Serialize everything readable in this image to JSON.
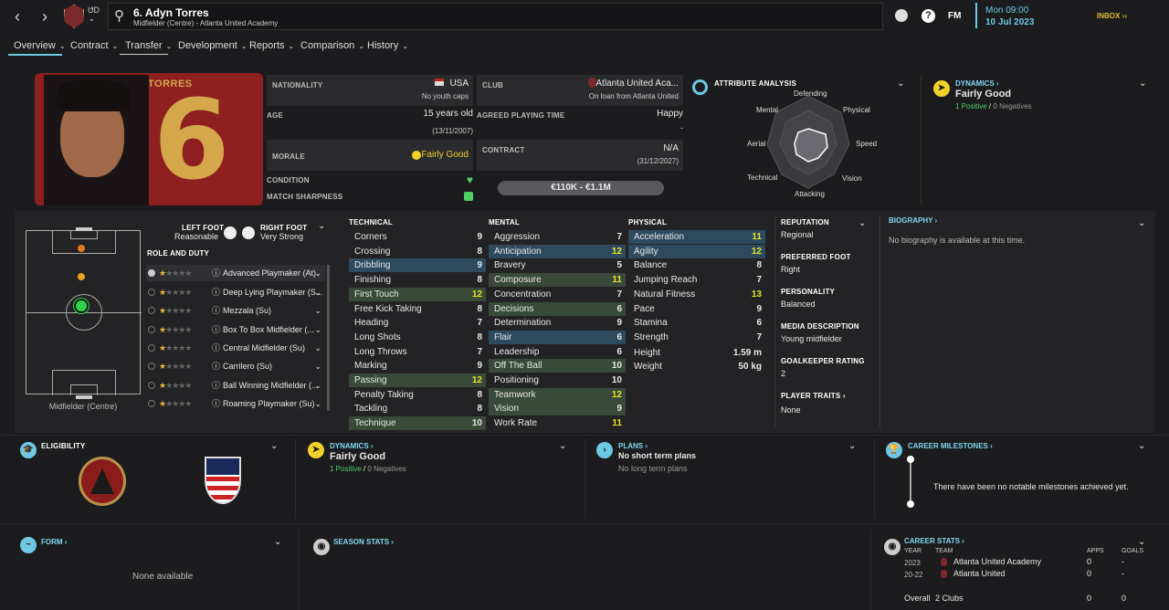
{
  "header": {
    "player_title": "6. Adyn Torres",
    "player_subtitle": "Midfielder (Centre) - Atlanta United Academy",
    "club_initials": "UD",
    "date_time": "Mon 09:00",
    "date": "10 Jul 2023",
    "inbox": "INBOX",
    "fm": "FM",
    "help": "?"
  },
  "tabs": [
    {
      "label": "Overview"
    },
    {
      "label": "Contract"
    },
    {
      "label": "Transfer"
    },
    {
      "label": "Development"
    },
    {
      "label": "Reports"
    },
    {
      "label": "Comparison"
    },
    {
      "label": "History"
    }
  ],
  "photo": {
    "shirt_name": "TORRES",
    "shirt_number": "6"
  },
  "info": {
    "nationality_label": "NATIONALITY",
    "nationality": "USA",
    "youth_caps": "No youth caps",
    "age_label": "AGE",
    "age": "15 years old",
    "dob": "(13/11/2007)",
    "morale_label": "MORALE",
    "morale": "Fairly Good",
    "condition_label": "CONDITION",
    "sharpness_label": "MATCH SHARPNESS",
    "club_label": "CLUB",
    "club": "Atlanta United Aca...",
    "loan": "On loan from Atlanta United",
    "apt_label": "AGREED PLAYING TIME",
    "apt": "Happy",
    "apt_dash": "-",
    "contract_label": "CONTRACT",
    "contract": "N/A",
    "contract_date": "(31/12/2027)",
    "value": "€110K - €1.1M"
  },
  "attribute_analysis": {
    "title": "ATTRIBUTE ANALYSIS",
    "labels": [
      "Defending",
      "Physical",
      "Speed",
      "Vision",
      "Attacking",
      "Technical",
      "Aerial",
      "Mental"
    ]
  },
  "dynamics": {
    "title": "DYNAMICS",
    "status": "Fairly Good",
    "positive": "1 Positive",
    "sep": "/",
    "negative": "0 Negatives"
  },
  "pitch": {
    "position": "Midfielder (Centre)",
    "left_foot_label": "LEFT FOOT",
    "left_foot": "Reasonable",
    "right_foot_label": "RIGHT FOOT",
    "right_foot": "Very Strong",
    "role_title": "ROLE AND DUTY"
  },
  "roles": [
    "Advanced Playmaker (At)",
    "Deep Lying Playmaker (S...",
    "Mezzala (Su)",
    "Box To Box Midfielder (...",
    "Central Midfielder (Su)",
    "Carrilero (Su)",
    "Ball Winning Midfielder (...",
    "Roaming Playmaker (Su)"
  ],
  "technical": {
    "title": "TECHNICAL",
    "rows": [
      [
        "Corners",
        "9"
      ],
      [
        "Crossing",
        "8"
      ],
      [
        "Dribbling",
        "9"
      ],
      [
        "Finishing",
        "8"
      ],
      [
        "First Touch",
        "12"
      ],
      [
        "Free Kick Taking",
        "8"
      ],
      [
        "Heading",
        "7"
      ],
      [
        "Long Shots",
        "8"
      ],
      [
        "Long Throws",
        "7"
      ],
      [
        "Marking",
        "9"
      ],
      [
        "Passing",
        "12"
      ],
      [
        "Penalty Taking",
        "8"
      ],
      [
        "Tackling",
        "8"
      ],
      [
        "Technique",
        "10"
      ]
    ]
  },
  "mental": {
    "title": "MENTAL",
    "rows": [
      [
        "Aggression",
        "7"
      ],
      [
        "Anticipation",
        "12"
      ],
      [
        "Bravery",
        "5"
      ],
      [
        "Composure",
        "11"
      ],
      [
        "Concentration",
        "7"
      ],
      [
        "Decisions",
        "6"
      ],
      [
        "Determination",
        "9"
      ],
      [
        "Flair",
        "6"
      ],
      [
        "Leadership",
        "6"
      ],
      [
        "Off The Ball",
        "10"
      ],
      [
        "Positioning",
        "10"
      ],
      [
        "Teamwork",
        "12"
      ],
      [
        "Vision",
        "9"
      ],
      [
        "Work Rate",
        "11"
      ]
    ]
  },
  "physical": {
    "title": "PHYSICAL",
    "rows": [
      [
        "Acceleration",
        "11"
      ],
      [
        "Agility",
        "12"
      ],
      [
        "Balance",
        "8"
      ],
      [
        "Jumping Reach",
        "7"
      ],
      [
        "Natural Fitness",
        "13"
      ],
      [
        "Pace",
        "9"
      ],
      [
        "Stamina",
        "6"
      ],
      [
        "Strength",
        "7"
      ]
    ],
    "height_label": "Height",
    "height": "1.59 m",
    "weight_label": "Weight",
    "weight": "50 kg"
  },
  "profile": {
    "reputation_label": "REPUTATION",
    "reputation": "Regional",
    "foot_label": "PREFERRED FOOT",
    "foot": "Right",
    "personality_label": "PERSONALITY",
    "personality": "Balanced",
    "media_label": "MEDIA DESCRIPTION",
    "media": "Young midfielder",
    "gk_label": "GOALKEEPER RATING",
    "gk": "2",
    "traits_label": "PLAYER TRAITS",
    "traits": "None"
  },
  "biography": {
    "title": "BIOGRAPHY",
    "text": "No biography is available at this time."
  },
  "eligibility": {
    "title": "ELIGIBILITY"
  },
  "plans": {
    "title": "PLANS",
    "short": "No short term plans",
    "long": "No long term plans"
  },
  "milestones": {
    "title": "CAREER MILESTONES",
    "text": "There have been no notable milestones achieved yet."
  },
  "form": {
    "title": "FORM",
    "text": "None available"
  },
  "season_stats": {
    "title": "SEASON STATS"
  },
  "career_stats": {
    "title": "CAREER STATS",
    "headers": [
      "YEAR",
      "TEAM",
      "APPS",
      "GOALS"
    ],
    "rows": [
      [
        "2023",
        "Atlanta United Academy",
        "0",
        "-"
      ],
      [
        "20-22",
        "Atlanta United",
        "0",
        "-"
      ]
    ],
    "overall_label": "Overall",
    "overall_clubs": "2 Clubs",
    "overall_apps": "0",
    "overall_goals": "0"
  },
  "colors": {
    "accent": "#6ec8e3",
    "positive": "#4fd16a",
    "highlight": "#e5e52a",
    "dynamics": "#f0d22a"
  }
}
